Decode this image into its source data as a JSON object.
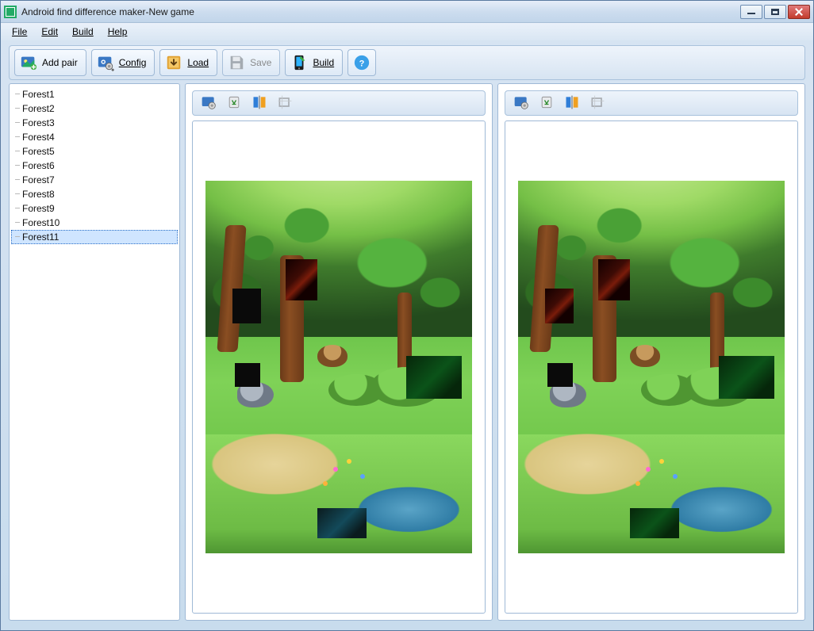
{
  "window": {
    "title": "Android find difference maker-New game"
  },
  "menu": {
    "file": "File",
    "edit": "Edit",
    "build": "Build",
    "help": "Help"
  },
  "toolbar": {
    "add_pair": "Add pair",
    "config": "Config",
    "load": "Load",
    "save": "Save",
    "build": "Build",
    "help_tooltip": "Help"
  },
  "tree": {
    "items": [
      "Forest1",
      "Forest2",
      "Forest3",
      "Forest4",
      "Forest5",
      "Forest6",
      "Forest7",
      "Forest8",
      "Forest9",
      "Forest10",
      "Forest11"
    ],
    "selected_index": 10
  },
  "editor_icons": {
    "image_settings": "image-settings-icon",
    "recycle": "recycle-icon",
    "flip": "flip-icon",
    "crop": "crop-icon"
  },
  "colors": {
    "accent": "#3a78c4",
    "panel_border": "#9fb9d6",
    "selection": "#cfe5ff"
  }
}
